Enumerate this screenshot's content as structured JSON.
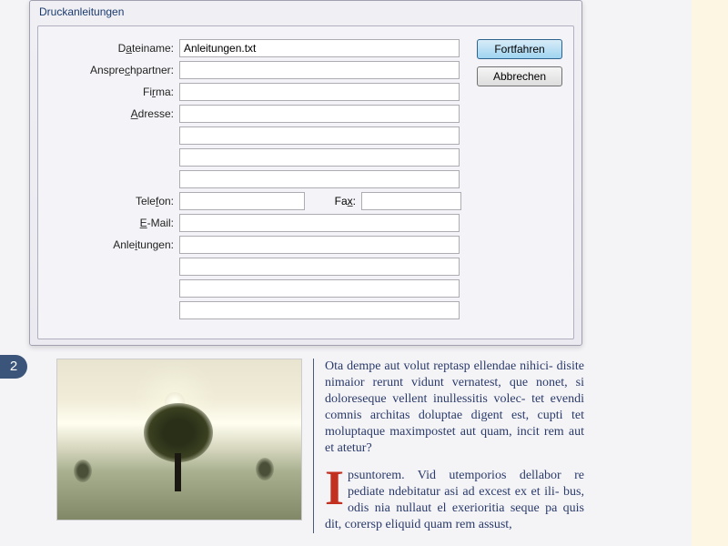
{
  "dialog": {
    "title": "Druckanleitungen",
    "buttons": {
      "continue": "Fortfahren",
      "cancel": "Abbrechen"
    },
    "labels": {
      "filename_pre": "D",
      "filename_u": "a",
      "filename_post": "teiname:",
      "contact_pre": "Anspre",
      "contact_u": "c",
      "contact_post": "hpartner:",
      "company_pre": "Fi",
      "company_u": "r",
      "company_post": "ma:",
      "address_pre": "",
      "address_u": "A",
      "address_post": "dresse:",
      "phone_pre": "Tele",
      "phone_u": "f",
      "phone_post": "on:",
      "fax_pre": "Fa",
      "fax_u": "x",
      "fax_post": ":",
      "email_pre": "",
      "email_u": "E",
      "email_post": "-Mail:",
      "instructions_pre": "Anle",
      "instructions_u": "i",
      "instructions_post": "tungen:"
    },
    "values": {
      "filename": "Anleitungen.txt",
      "contact": "",
      "company": "",
      "address1": "",
      "address2": "",
      "address3": "",
      "address4": "",
      "phone": "",
      "fax": "",
      "email": "",
      "instr1": "",
      "instr2": "",
      "instr3": "",
      "instr4": ""
    }
  },
  "page": {
    "number": "2",
    "para1": "Ota dempe aut volut reptasp ellendae nihici- disite nimaior rerunt vidunt vernatest, que nonet, si doloreseque vellent inullessitis volec- tet evendi comnis architas doluptae digent est, cupti tet moluptaque maximpostet aut quam, incit rem aut et atetur?",
    "dropcap": "I",
    "para2": "psuntorem. Vid utemporios dellabor re pediate ndebitatur asi ad excest ex et ili- bus, odis nia nullaut el exerioritia seque pa quis dit, corersp eliquid quam rem assust,"
  }
}
